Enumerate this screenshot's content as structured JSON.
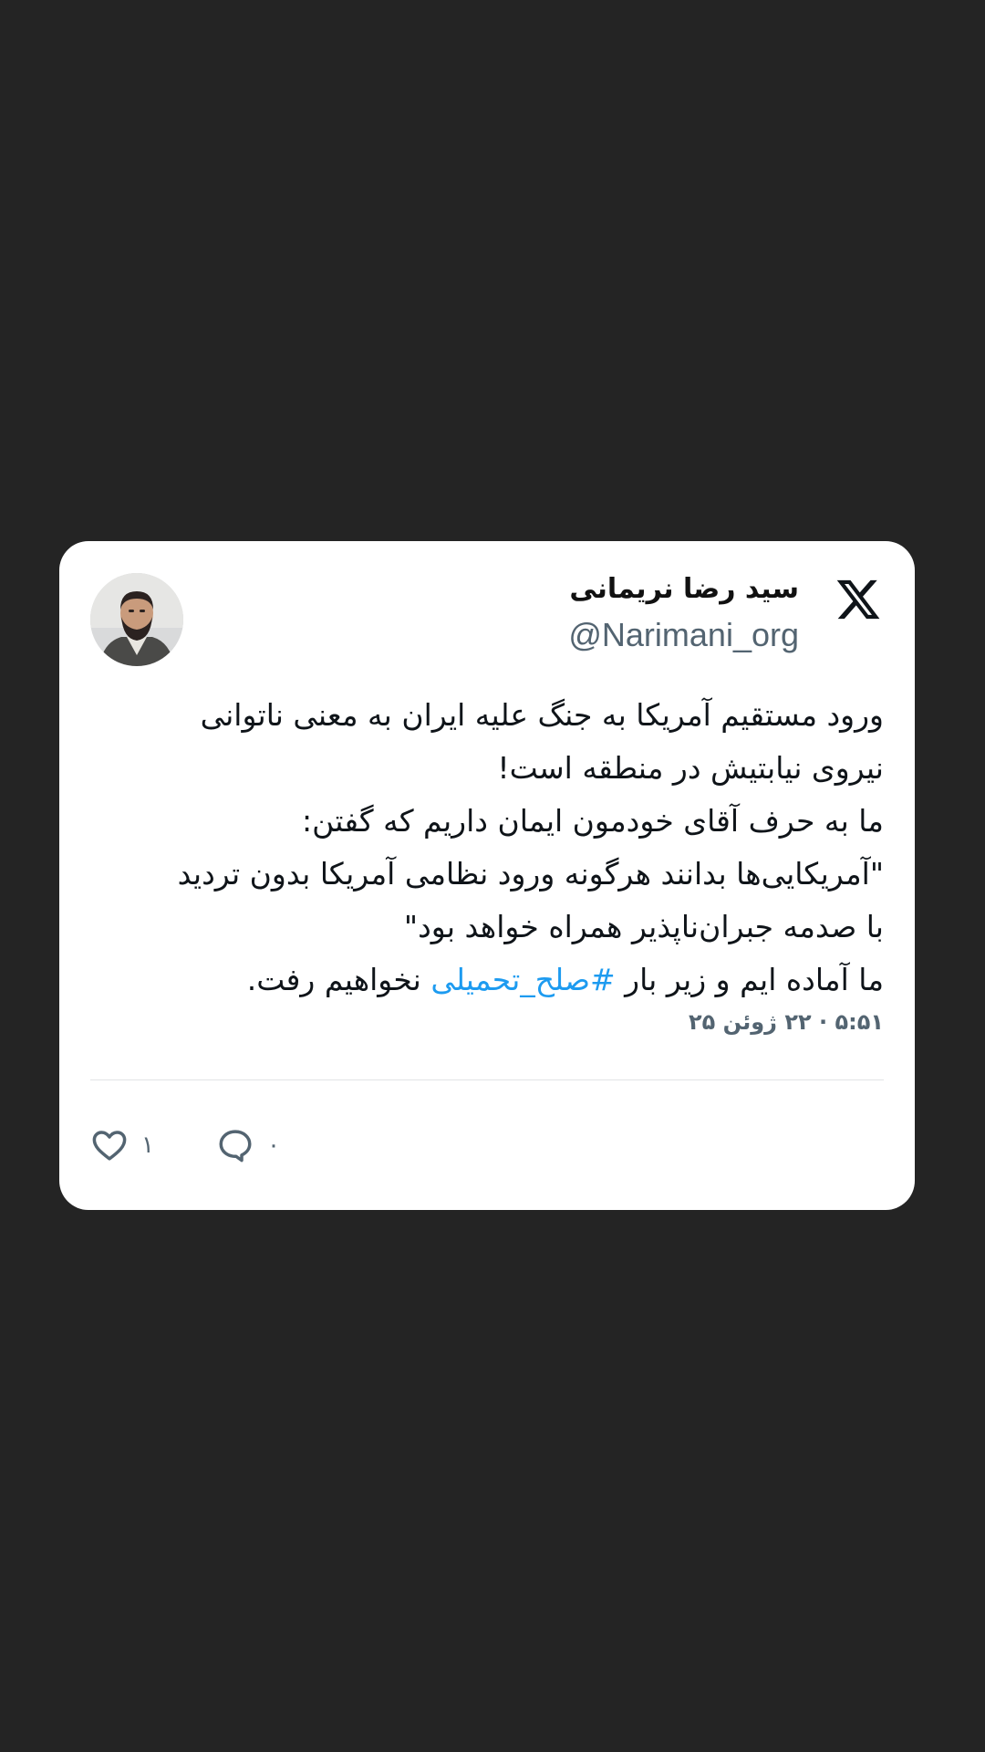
{
  "tweet": {
    "author_name": "سید رضا نریمانی",
    "handle": "@Narimani_org",
    "lines": [
      "ورود مستقیم آمریکا به جنگ علیه ایران به معنی ناتوانی",
      "نیروی نیابتیش در منطقه است!",
      "ما به حرف آقای خودمون ایمان داریم که گفتن:",
      "\"آمریکایی‌ها بدانند هرگونه ورود نظامی آمریکا بدون تردید",
      "با صدمه جبران‌ناپذیر همراه خواهد بود\""
    ],
    "last_line_before": "ما آماده ایم و زیر بار ",
    "hashtag": "#صلح_تحمیلی",
    "last_line_after": " نخواهیم رفت.",
    "timestamp": "۵:۵۱ · ۲۲ ژوئن ۲۵",
    "likes_count": "۱",
    "replies_count": "۰",
    "colors": {
      "background": "#242424",
      "card": "#ffffff",
      "text": "#0f1419",
      "secondary": "#536471",
      "hashtag": "#1d9bf0"
    },
    "icons": {
      "logo": "x-logo-icon",
      "like": "heart-icon",
      "reply": "reply-bubble-icon"
    }
  }
}
